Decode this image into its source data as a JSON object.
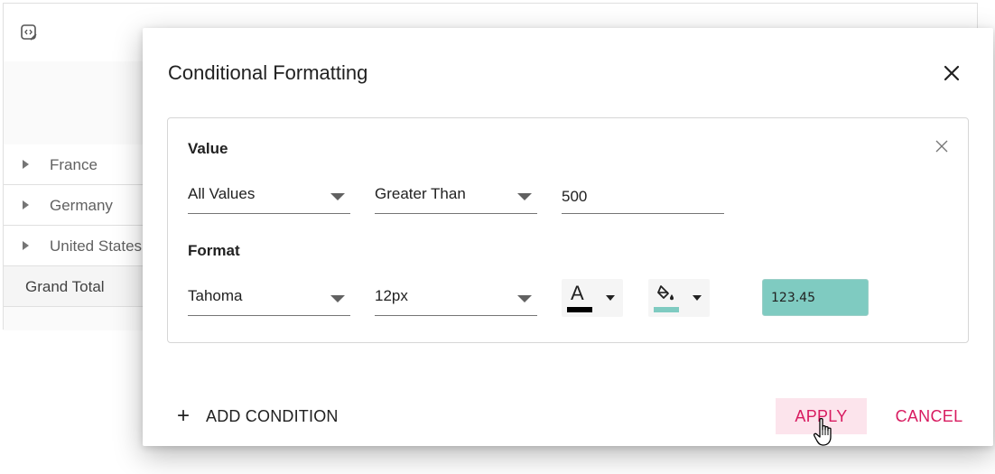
{
  "grid": {
    "rows": [
      {
        "label": "France"
      },
      {
        "label": "Germany"
      },
      {
        "label": "United States"
      }
    ],
    "total_label": "Grand Total"
  },
  "dialog": {
    "title": "Conditional Formatting",
    "value_section_label": "Value",
    "measure": {
      "selected": "All Values"
    },
    "operator": {
      "selected": "Greater Than"
    },
    "value": "500",
    "format_section_label": "Format",
    "font_family": {
      "selected": "Tahoma"
    },
    "font_size": {
      "selected": "12px"
    },
    "font_color": {
      "glyph": "A",
      "color": "#000000"
    },
    "background_color": {
      "color": "#7fcbc1",
      "icon": "paint-bucket-icon"
    },
    "preview_text": "123.45",
    "add_condition_label": "ADD CONDITION",
    "apply_label": "APPLY",
    "cancel_label": "CANCEL"
  },
  "colors": {
    "accent": "#d81b60",
    "apply_hover_bg": "#fce4ec",
    "preview_bg": "#7fcbc1"
  }
}
